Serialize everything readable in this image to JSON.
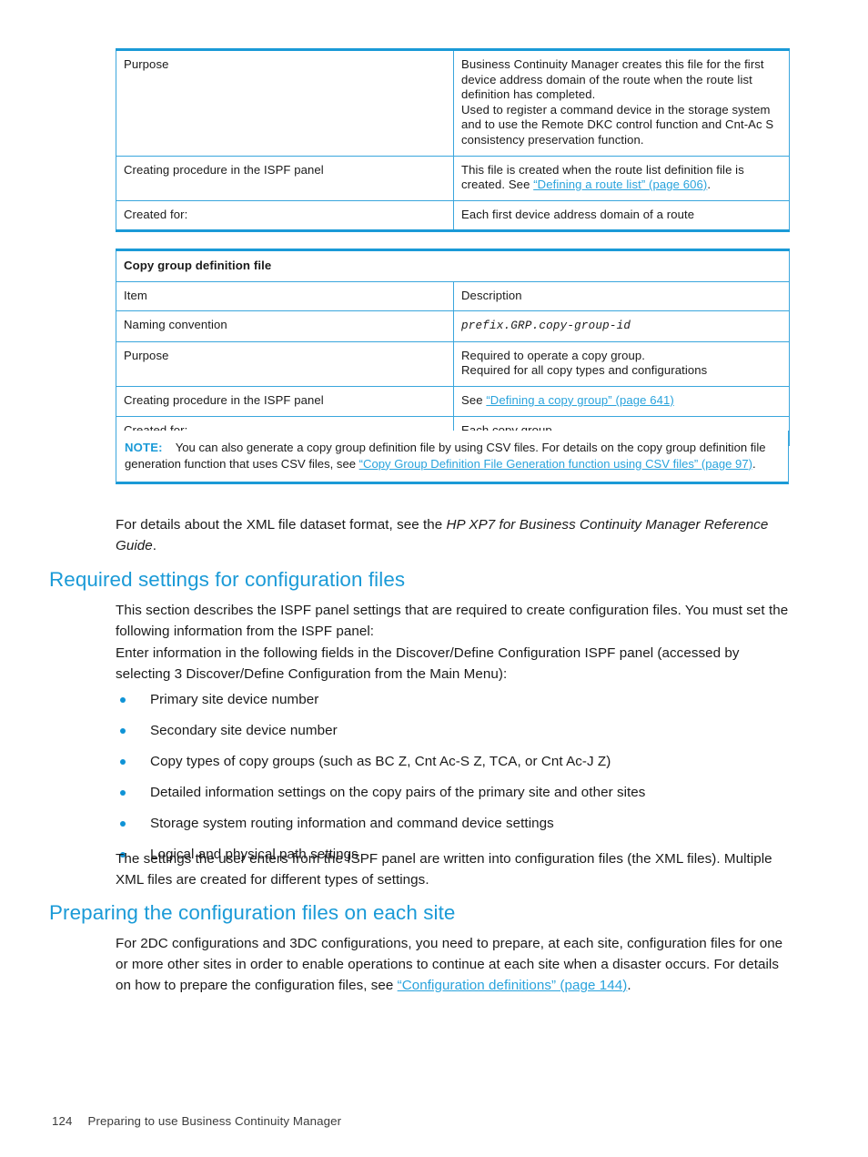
{
  "colors": {
    "accent_blue": "#1a9ad7",
    "link_blue": "#29a3dc",
    "heading_blue": "#1a9ad7",
    "table_border": "#3aa6dd",
    "bullet": "#0f93d6",
    "text": "#1a1a1a"
  },
  "table_route": {
    "columns": [
      "",
      ""
    ],
    "rows": [
      {
        "item": "Purpose",
        "description_lines": [
          "Business Continuity Manager creates this file for the first",
          "device address domain of the route when the route list",
          "definition has completed.",
          "Used to register a command device in the storage system",
          "and to use the Remote DKC control function and Cnt-Ac S",
          "consistency preservation function."
        ]
      },
      {
        "item": "Creating procedure in the ISPF panel",
        "description_prefix": "This file is created when the route list definition file is created. See ",
        "description_link": "“Defining a route list” (page 606)",
        "description_suffix": "."
      },
      {
        "item": "Created for:",
        "description": "Each first device address domain of a route"
      }
    ]
  },
  "table_copygroup": {
    "caption": "Copy group definition file",
    "header": {
      "item": "Item",
      "description": "Description"
    },
    "rows": [
      {
        "item": "Naming convention",
        "description_mono": "prefix.GRP.copy-group-id"
      },
      {
        "item": "Purpose",
        "description_lines": [
          "Required to operate a copy group.",
          "Required for all copy types and configurations"
        ]
      },
      {
        "item": "Creating procedure in the ISPF panel",
        "description_prefix": "See ",
        "description_link": "“Defining a copy group” (page 641)",
        "description_suffix": ""
      },
      {
        "item": "Created for:",
        "description": "Each copy group"
      }
    ]
  },
  "note": {
    "label": "NOTE:",
    "text_before": "You can also generate a copy group definition file by using CSV files. For details on the copy group definition file generation function that uses CSV files, see ",
    "link": "“Copy Group Definition File Generation function using CSV files” (page 97)",
    "text_after": "."
  },
  "intro_paragraph": {
    "text_before": "For details about the XML file dataset format, see the ",
    "italic": "HP XP7 for Business Continuity Manager Reference Guide",
    "text_after": "."
  },
  "section_required": {
    "heading": "Required settings for configuration files",
    "paragraph_1": "This section describes the ISPF panel settings that are required to create configuration files. You must set the following information from the ISPF panel:",
    "paragraph_2": "Enter information in the following fields in the Discover/Define Configuration ISPF panel (accessed by selecting 3 Discover/Define Configuration from the Main Menu):",
    "bullets": [
      "Primary site device number",
      "Secondary site device number",
      "Copy types of copy groups (such as BC Z, Cnt Ac-S Z, TCA, or Cnt Ac-J Z)",
      "Detailed information settings on the copy pairs of the primary site and other sites",
      "Storage system routing information and command device settings",
      "Logical and physical path settings"
    ],
    "paragraph_3": "The settings the user enters from the ISPF panel are written into configuration files (the XML files). Multiple XML files are created for different types of settings."
  },
  "section_preparing": {
    "heading": "Preparing the configuration files on each site",
    "paragraph_before": "For 2DC configurations and 3DC configurations, you need to prepare, at each site, configuration files for one or more other sites in order to enable operations to continue at each site when a disaster occurs. For details on how to prepare the configuration files, see ",
    "link": "“Configuration definitions” (page 144)",
    "paragraph_after": "."
  },
  "footer": {
    "page_number": "124",
    "chapter_title": "Preparing to use Business Continuity Manager"
  }
}
